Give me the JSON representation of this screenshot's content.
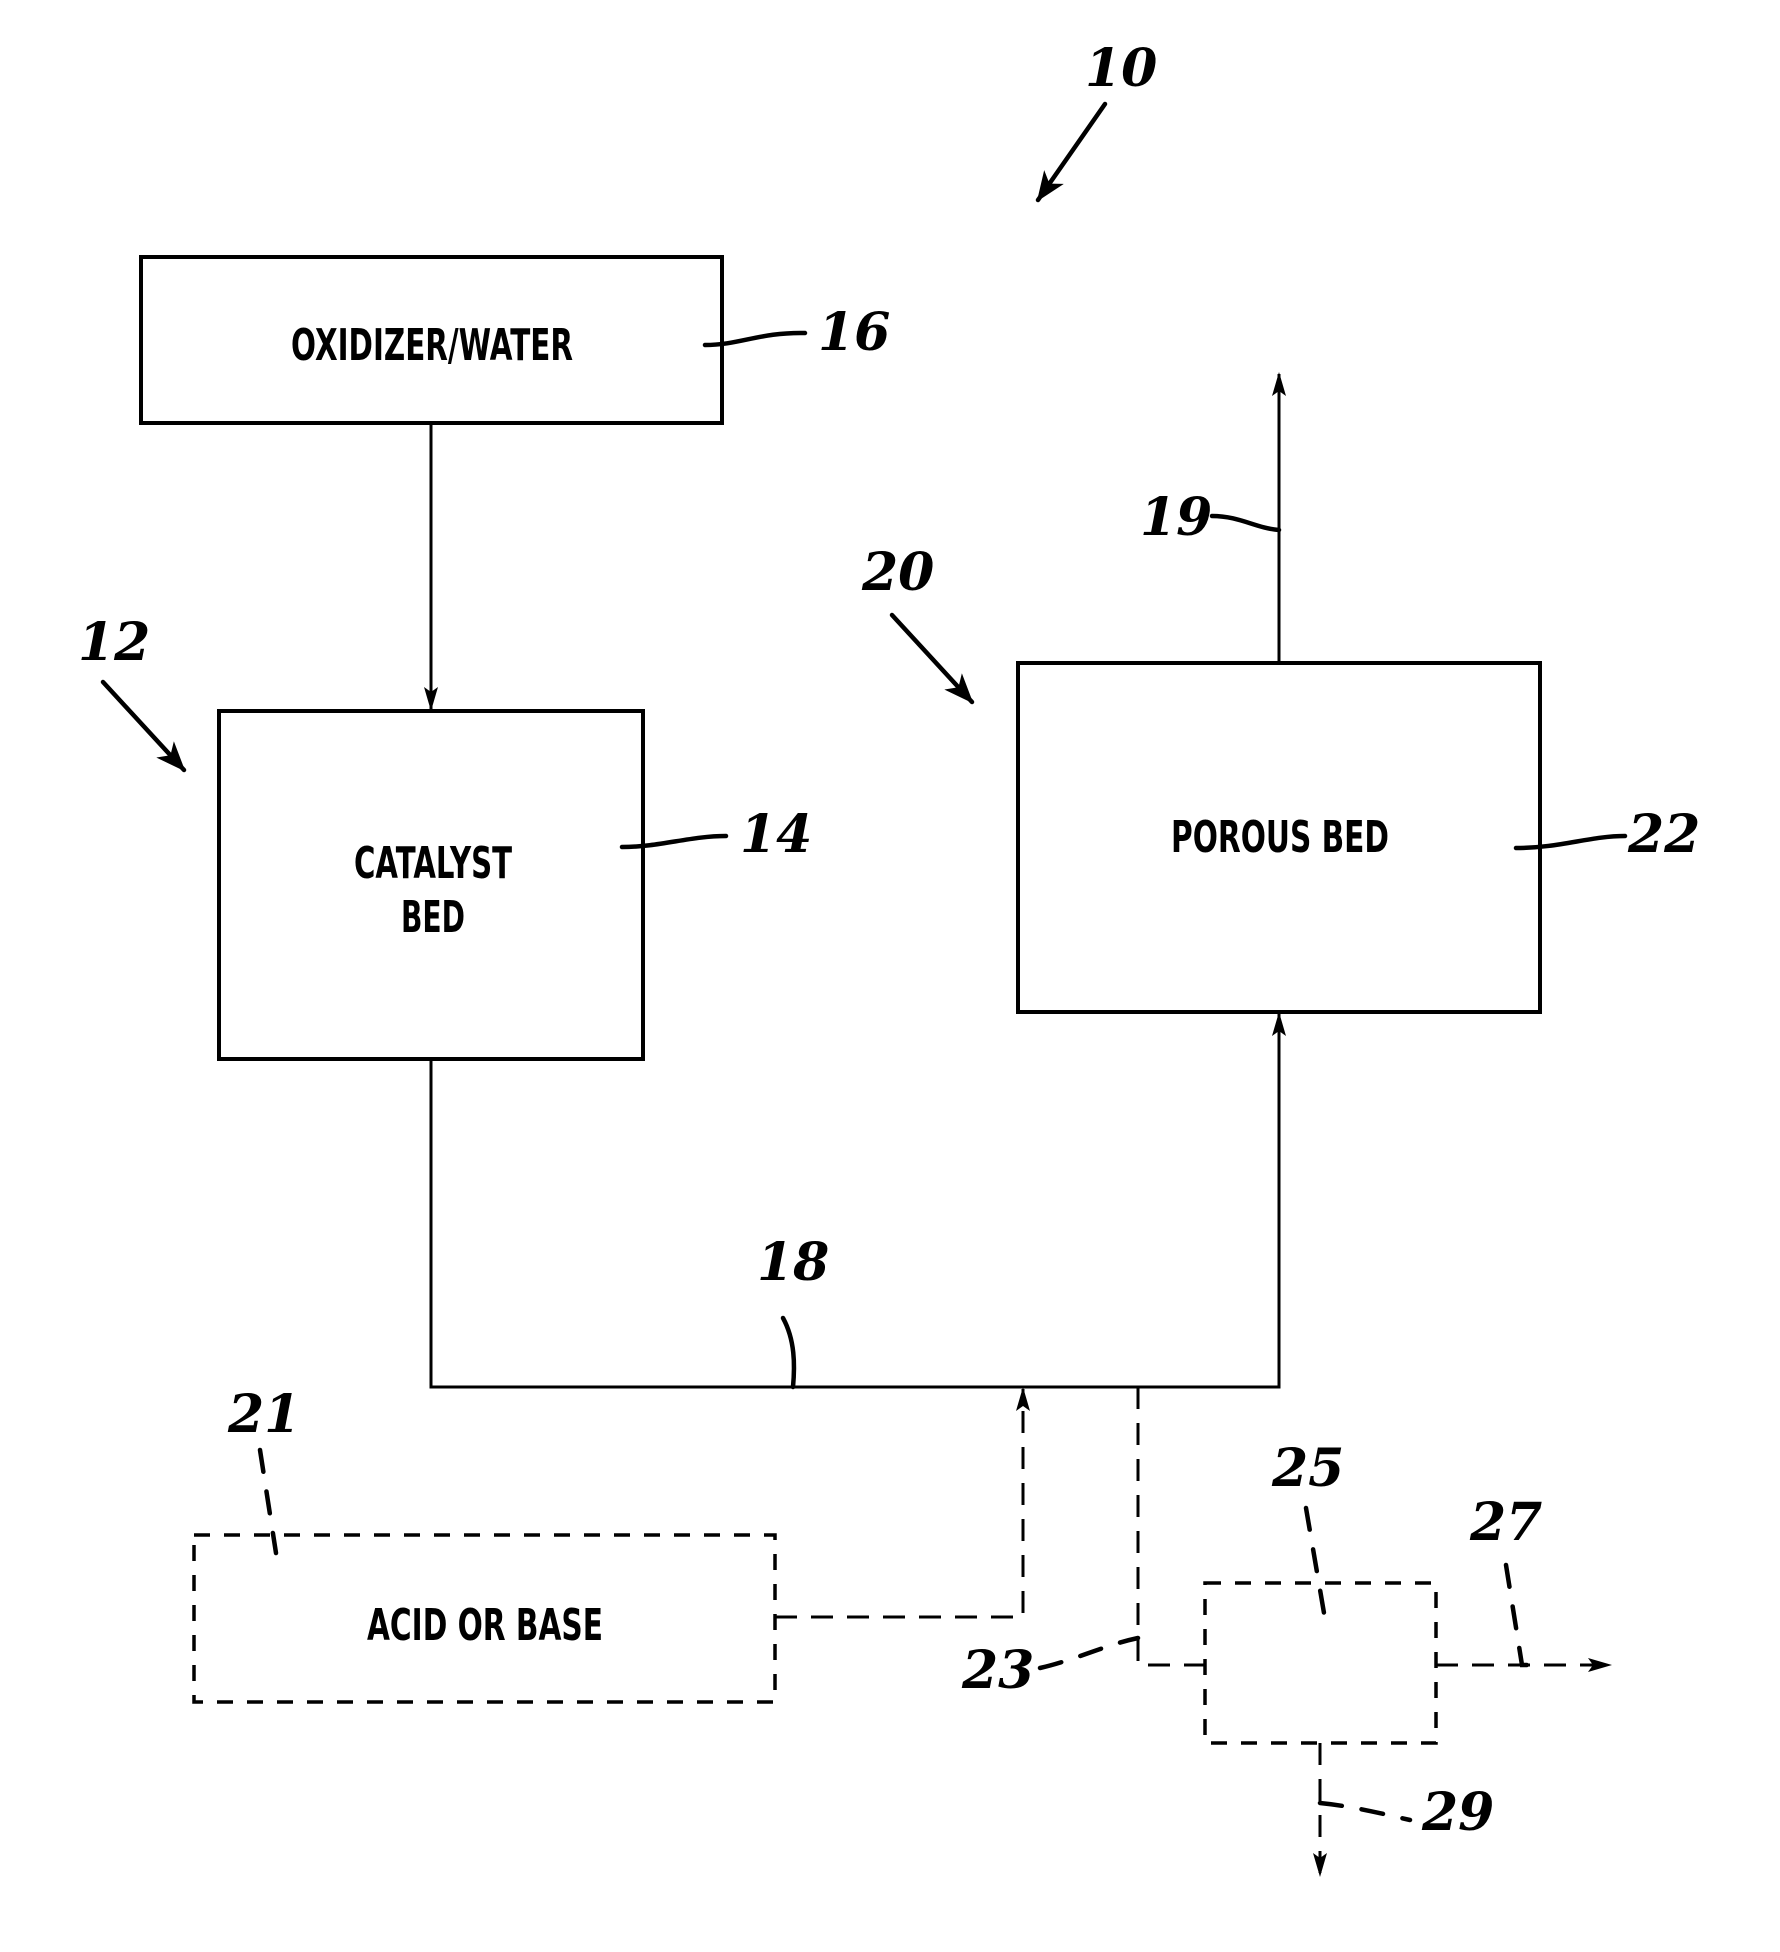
{
  "figure": {
    "system_ref": "10",
    "blocks": {
      "oxidizer": {
        "label": "OXIDIZER/WATER",
        "ref": "16"
      },
      "catalyst": {
        "label_line1": "CATALYST",
        "label_line2": "BED",
        "ref": "14",
        "group_ref": "12"
      },
      "porous": {
        "label": "POROUS BED",
        "ref": "22",
        "group_ref": "20"
      },
      "acid_base": {
        "label": "ACID OR BASE",
        "ref": "21",
        "optional": true
      },
      "separator": {
        "label": "",
        "ref": "25",
        "optional": true
      }
    },
    "streams": {
      "outlet": {
        "ref": "19"
      },
      "connector": {
        "ref": "18"
      },
      "split": {
        "ref": "23"
      },
      "separator_out_right": {
        "ref": "27"
      },
      "separator_out_down": {
        "ref": "29"
      }
    }
  }
}
